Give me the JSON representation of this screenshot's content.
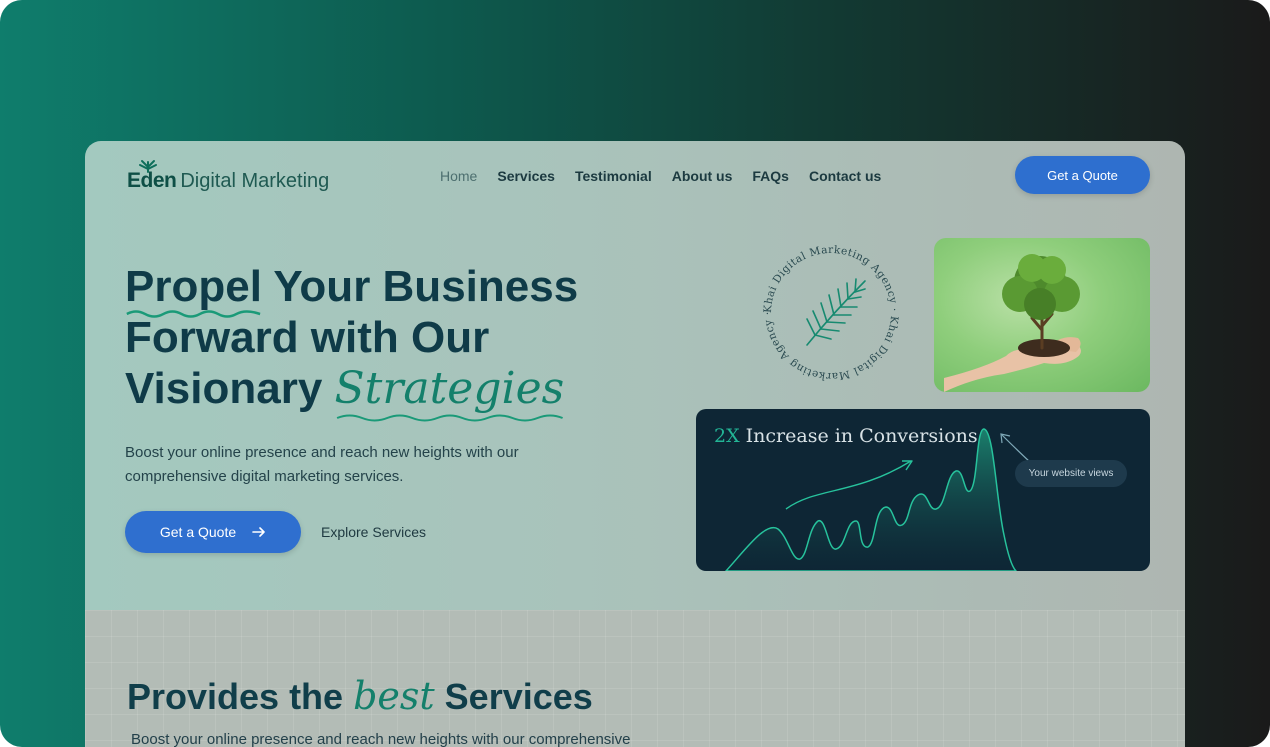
{
  "brand": {
    "name_bold": "Eden",
    "name_rest": "Digital Marketing"
  },
  "nav": {
    "items": [
      "Home",
      "Services",
      "Testimonial",
      "About us",
      "FAQs",
      "Contact us"
    ],
    "active": "Home",
    "cta_label": "Get a Quote"
  },
  "hero": {
    "title_part1": "Propel",
    "title_part2": " Your Business Forward with Our Visionary ",
    "title_script": "Strategies",
    "description": "Boost your online presence and reach new heights with our comprehensive digital marketing services.",
    "primary_cta": "Get a Quote",
    "primary_cta_icon": "arrow-right-icon",
    "secondary_cta": "Explore Services"
  },
  "badge": {
    "circular_text": "Khai Digital Marketing Agency · Khai Digital Marketing Agency ·",
    "icon": "palm-leaf-icon"
  },
  "tree_image": {
    "icon": "tree-in-hand-image"
  },
  "conversion_card": {
    "highlight": "2X",
    "title": " Increase in Conversions",
    "pill_label": "Your website views"
  },
  "services": {
    "title_part1": "Provides the ",
    "title_script": "best",
    "title_part2": " Services",
    "description": "Boost your online presence and reach new heights with our comprehensive"
  },
  "colors": {
    "primary_button": "#2f6fcf",
    "heading": "#0f3b48",
    "accent_green": "#14806b",
    "card_dark": "#0e2635"
  }
}
